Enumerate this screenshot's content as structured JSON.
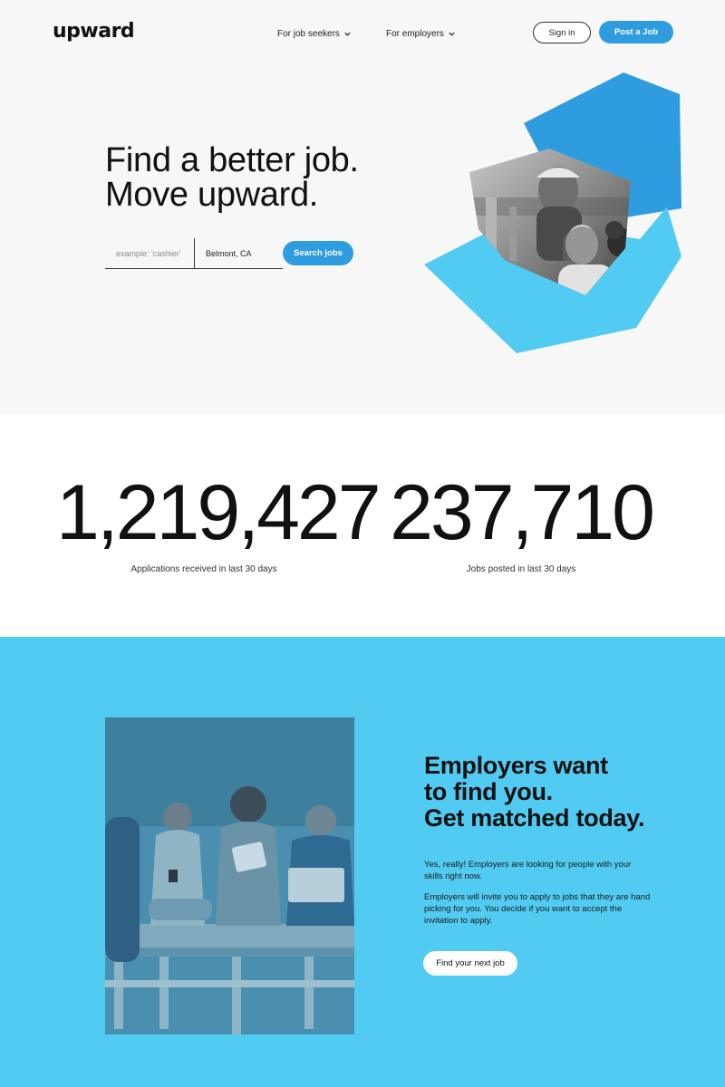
{
  "header": {
    "logo": "upward",
    "nav": [
      {
        "label": "For job seekers"
      },
      {
        "label": "For employers"
      }
    ],
    "sign_in": "Sign in",
    "post_job": "Post a Job"
  },
  "hero": {
    "headline_line1": "Find a better job.",
    "headline_line2": "Move upward.",
    "search": {
      "what_placeholder": "example: 'cashier'",
      "where_value": "Belmont, CA",
      "button": "Search jobs"
    }
  },
  "stats": [
    {
      "number": "1,219,427",
      "label": "Applications received in last 30 days"
    },
    {
      "number": "237,710",
      "label": "Jobs posted in last 30 days"
    }
  ],
  "match": {
    "title_line1": "Employers want",
    "title_line2": "to find you.",
    "title_line3": "Get matched today.",
    "paragraph1": "Yes, really! Employers are looking for people with your skills right now.",
    "paragraph2": "Employers will invite you to apply to jobs that they are hand picking for you. You decide if you want to accept the invitation to apply.",
    "button": "Find your next job"
  },
  "colors": {
    "accent_blue": "#2f9cdf",
    "light_blue": "#52cbf2",
    "hero_bg": "#f7f7f7"
  }
}
